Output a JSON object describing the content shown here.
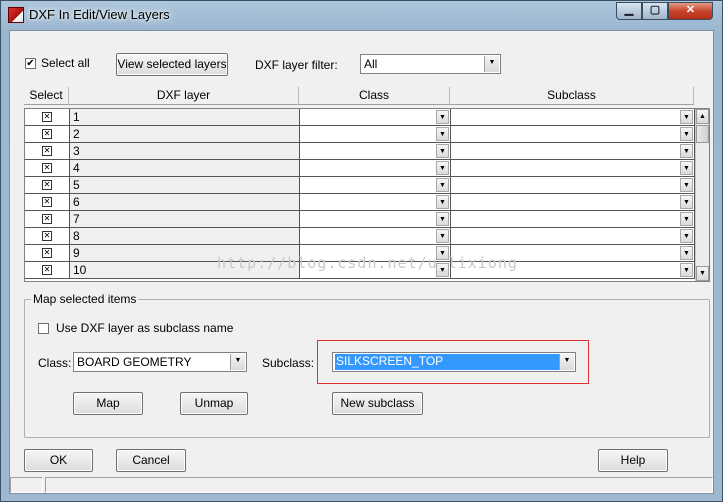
{
  "window": {
    "title": "DXF In Edit/View Layers",
    "close_glyph": "✕",
    "min_glyph": "▁",
    "max_glyph": "▢"
  },
  "top": {
    "select_all_label": "Select all",
    "select_all_checked": "✔",
    "view_selected_label": "View selected layers",
    "filter_label": "DXF layer filter:",
    "filter_value": "All"
  },
  "grid": {
    "headers": [
      "Select",
      "DXF layer",
      "Class",
      "Subclass"
    ],
    "rows": [
      {
        "layer": "1",
        "mark": "✕"
      },
      {
        "layer": "2",
        "mark": "✕"
      },
      {
        "layer": "3",
        "mark": "✕"
      },
      {
        "layer": "4",
        "mark": "✕"
      },
      {
        "layer": "5",
        "mark": "✕"
      },
      {
        "layer": "6",
        "mark": "✕"
      },
      {
        "layer": "7",
        "mark": "✕"
      },
      {
        "layer": "8",
        "mark": "✕"
      },
      {
        "layer": "9",
        "mark": "✕"
      },
      {
        "layer": "10",
        "mark": "✕"
      }
    ],
    "dropdown_glyph": "▼",
    "scroll_up_glyph": "▲",
    "scroll_down_glyph": "▼"
  },
  "map_group": {
    "title": "Map selected items",
    "use_dxf_label": "Use DXF layer as subclass name",
    "class_label": "Class:",
    "class_value": "BOARD GEOMETRY",
    "subclass_label": "Subclass:",
    "subclass_value": "SILKSCREEN_TOP",
    "map_button": "Map",
    "unmap_button": "Unmap",
    "new_subclass_button": "New subclass"
  },
  "footer": {
    "ok": "OK",
    "cancel": "Cancel",
    "help": "Help"
  },
  "watermark": "http://blog.csdn.net/u_lixiong",
  "colors": {
    "highlight_box": "#e03030",
    "selection": "#3399ff"
  }
}
